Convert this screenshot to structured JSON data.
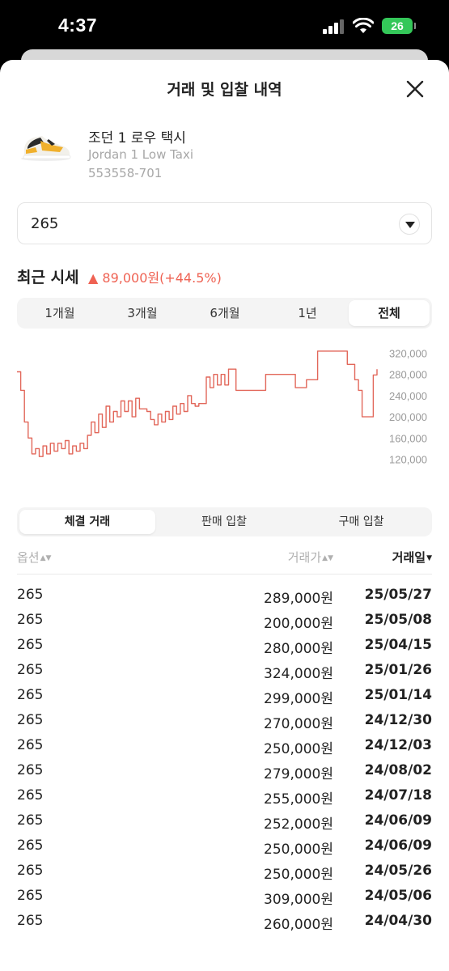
{
  "status_bar": {
    "time": "4:37",
    "battery": "26"
  },
  "header": {
    "title": "거래 및 입찰 내역"
  },
  "product": {
    "name_kr": "조던 1 로우 택시",
    "name_en": "Jordan 1 Low Taxi",
    "code": "553558-701"
  },
  "size_select": {
    "value": "265"
  },
  "recent_price": {
    "title": "최근 시세",
    "change": "▲ 89,000원(+44.5%)",
    "change_color": "#ef6253"
  },
  "period_tabs": [
    "1개월",
    "3개월",
    "6개월",
    "1년",
    "전체"
  ],
  "period_active": 4,
  "chart_data": {
    "type": "line",
    "title": "",
    "xlabel": "",
    "ylabel": "",
    "ylim": [
      110000,
      330000
    ],
    "y_ticks": [
      "320,000",
      "280,000",
      "240,000",
      "200,000",
      "160,000",
      "120,000"
    ],
    "color": "#e2675a",
    "series": [
      {
        "values": [
          285000,
          250000,
          190000,
          160000,
          130000,
          140000,
          125000,
          145000,
          130000,
          150000,
          135000,
          150000,
          140000,
          155000,
          130000,
          145000,
          135000,
          150000,
          140000,
          165000,
          190000,
          170000,
          205000,
          180000,
          220000,
          190000,
          210000,
          200000,
          230000,
          210000,
          230000,
          200000,
          235000,
          215000,
          215000,
          210000,
          195000,
          185000,
          205000,
          190000,
          210000,
          195000,
          220000,
          205000,
          225000,
          210000,
          240000,
          225000,
          220000,
          225000,
          225000,
          275000,
          255000,
          280000,
          260000,
          280000,
          260000,
          290000,
          290000,
          250000,
          250000,
          250000,
          250000,
          250000,
          250000,
          250000,
          250000,
          280000,
          280000,
          280000,
          280000,
          280000,
          280000,
          280000,
          280000,
          255000,
          255000,
          255000,
          270000,
          270000,
          270000,
          324000,
          324000,
          324000,
          324000,
          324000,
          324000,
          324000,
          324000,
          299000,
          299000,
          270000,
          250000,
          200000,
          200000,
          200000,
          279000,
          290000
        ]
      }
    ]
  },
  "trade_tabs": [
    "체결 거래",
    "판매 입찰",
    "구매 입찰"
  ],
  "trade_active": 0,
  "table": {
    "headers": {
      "option": "옵션",
      "price": "거래가",
      "date": "거래일"
    },
    "rows": [
      {
        "option": "265",
        "price": "289,000원",
        "date": "25/05/27"
      },
      {
        "option": "265",
        "price": "200,000원",
        "date": "25/05/08"
      },
      {
        "option": "265",
        "price": "280,000원",
        "date": "25/04/15"
      },
      {
        "option": "265",
        "price": "324,000원",
        "date": "25/01/26"
      },
      {
        "option": "265",
        "price": "299,000원",
        "date": "25/01/14"
      },
      {
        "option": "265",
        "price": "270,000원",
        "date": "24/12/30"
      },
      {
        "option": "265",
        "price": "250,000원",
        "date": "24/12/03"
      },
      {
        "option": "265",
        "price": "279,000원",
        "date": "24/08/02"
      },
      {
        "option": "265",
        "price": "255,000원",
        "date": "24/07/18"
      },
      {
        "option": "265",
        "price": "252,000원",
        "date": "24/06/09"
      },
      {
        "option": "265",
        "price": "250,000원",
        "date": "24/06/09"
      },
      {
        "option": "265",
        "price": "250,000원",
        "date": "24/05/26"
      },
      {
        "option": "265",
        "price": "309,000원",
        "date": "24/05/06"
      },
      {
        "option": "265",
        "price": "260,000원",
        "date": "24/04/30"
      }
    ]
  }
}
